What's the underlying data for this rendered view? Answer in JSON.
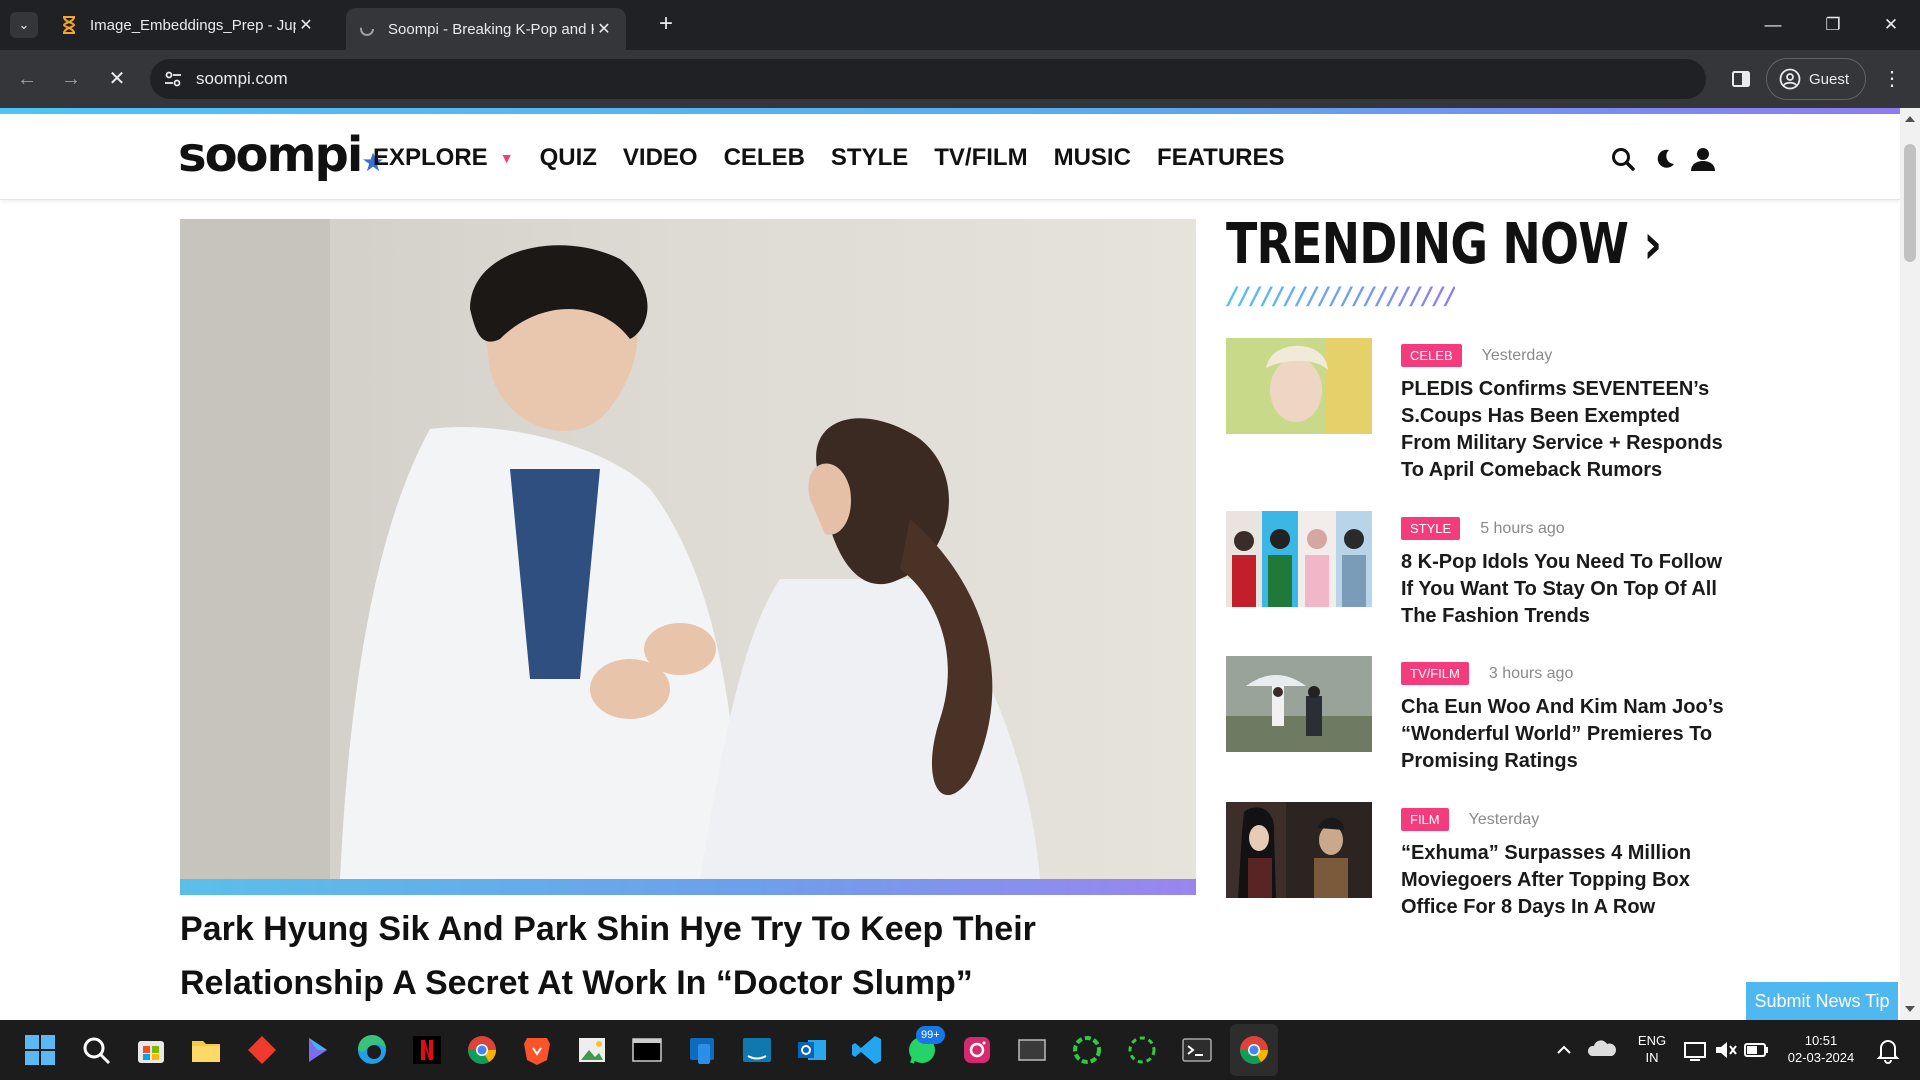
{
  "browser": {
    "tabs": [
      {
        "title": "Image_Embeddings_Prep - Jupyter",
        "favicon": "hourglass-icon",
        "active": false
      },
      {
        "title": "Soompi - Breaking K-Pop and K",
        "favicon": "loading-icon",
        "active": true
      }
    ],
    "new_tab": "+",
    "url": "soompi.com",
    "profile_label": "Guest"
  },
  "site": {
    "logo_text": "soompi",
    "nav": [
      {
        "label": "EXPLORE",
        "has_dropdown": true
      },
      {
        "label": "QUIZ"
      },
      {
        "label": "VIDEO"
      },
      {
        "label": "CELEB"
      },
      {
        "label": "STYLE"
      },
      {
        "label": "TV/FILM"
      },
      {
        "label": "MUSIC"
      },
      {
        "label": "FEATURES"
      }
    ],
    "accent_color": "#f43c7c",
    "brand_blue": "#4fb8f0"
  },
  "hero": {
    "title": "Park Hyung Sik And Park Shin Hye Try To Keep Their Relationship A Secret At Work In “Doctor Slump”"
  },
  "trending": {
    "heading": "TRENDING NOW",
    "arrow": "›",
    "divider": "////////////////////",
    "items": [
      {
        "category": "CELEB",
        "time": "Yesterday",
        "title": "PLEDIS Confirms SEVENTEEN’s S.Coups Has Been Exempted From Military Service + Responds To April Comeback Rumors"
      },
      {
        "category": "STYLE",
        "time": "5 hours ago",
        "title": "8 K-Pop Idols You Need To Follow If You Want To Stay On Top Of All The Fashion Trends"
      },
      {
        "category": "TV/FILM",
        "time": "3 hours ago",
        "title": "Cha Eun Woo And Kim Nam Joo’s “Wonderful World” Premieres To Promising Ratings"
      },
      {
        "category": "FILM",
        "time": "Yesterday",
        "title": "“Exhuma” Surpasses 4 Million Moviegoers After Topping Box Office For 8 Days In A Row"
      }
    ]
  },
  "submit_tip": "Submit News Tip",
  "taskbar": {
    "whatsapp_badge": "99+",
    "language": "ENG",
    "region": "IN",
    "time": "10:51",
    "date": "02-03-2024"
  }
}
